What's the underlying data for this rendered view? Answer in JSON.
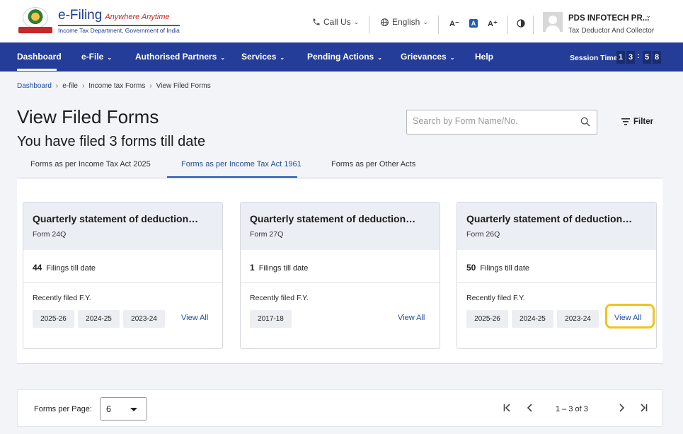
{
  "header": {
    "logo_title": "e-Filing",
    "logo_tagline": "Anywhere Anytime",
    "logo_subtitle": "Income Tax Department, Government of India",
    "call_us": "Call Us",
    "language": "English",
    "font_smaller": "A⁻",
    "font_normal": "A",
    "font_larger": "A⁺",
    "user_name": "PDS INFOTECH PR...",
    "user_role": "Tax Deductor And Collector"
  },
  "nav": {
    "items": [
      {
        "label": "Dashboard"
      },
      {
        "label": "e-File"
      },
      {
        "label": "Authorised Partners"
      },
      {
        "label": "Services"
      },
      {
        "label": "Pending Actions"
      },
      {
        "label": "Grievances"
      },
      {
        "label": "Help"
      }
    ],
    "session_label": "Session Time",
    "session_digits": [
      "1",
      "3",
      "5",
      "8"
    ]
  },
  "breadcrumb": [
    "Dashboard",
    "e-file",
    "Income tax Forms",
    "View Filed Forms"
  ],
  "page": {
    "title": "View Filed Forms",
    "subtitle": "You have filed 3 forms till date",
    "search_placeholder": "Search by Form Name/No.",
    "filter_label": "Filter"
  },
  "tabs": [
    {
      "label": "Forms as per Income Tax Act 2025"
    },
    {
      "label": "Forms as per Income Tax Act 1961"
    },
    {
      "label": "Forms as per Other Acts"
    }
  ],
  "cards": [
    {
      "title": "Quarterly statement of deduction…",
      "form": "Form 24Q",
      "count": "44",
      "count_label": "Filings till date",
      "recent_label": "Recently filed F.Y.",
      "years": [
        "2025-26",
        "2024-25",
        "2023-24"
      ],
      "view_all": "View All"
    },
    {
      "title": "Quarterly statement of deduction…",
      "form": "Form 27Q",
      "count": "1",
      "count_label": "Filings till date",
      "recent_label": "Recently filed F.Y.",
      "years": [
        "2017-18"
      ],
      "view_all": "View All"
    },
    {
      "title": "Quarterly statement of deduction…",
      "form": "Form 26Q",
      "count": "50",
      "count_label": "Filings till date",
      "recent_label": "Recently filed F.Y.",
      "years": [
        "2025-26",
        "2024-25",
        "2023-24"
      ],
      "view_all": "View All"
    }
  ],
  "pagination": {
    "per_page_label": "Forms per Page:",
    "per_page_value": "6",
    "range": "1 – 3 of 3"
  },
  "colors": {
    "nav_bg": "#243d98",
    "link": "#1f4d9a",
    "highlight": "#f0c419"
  }
}
